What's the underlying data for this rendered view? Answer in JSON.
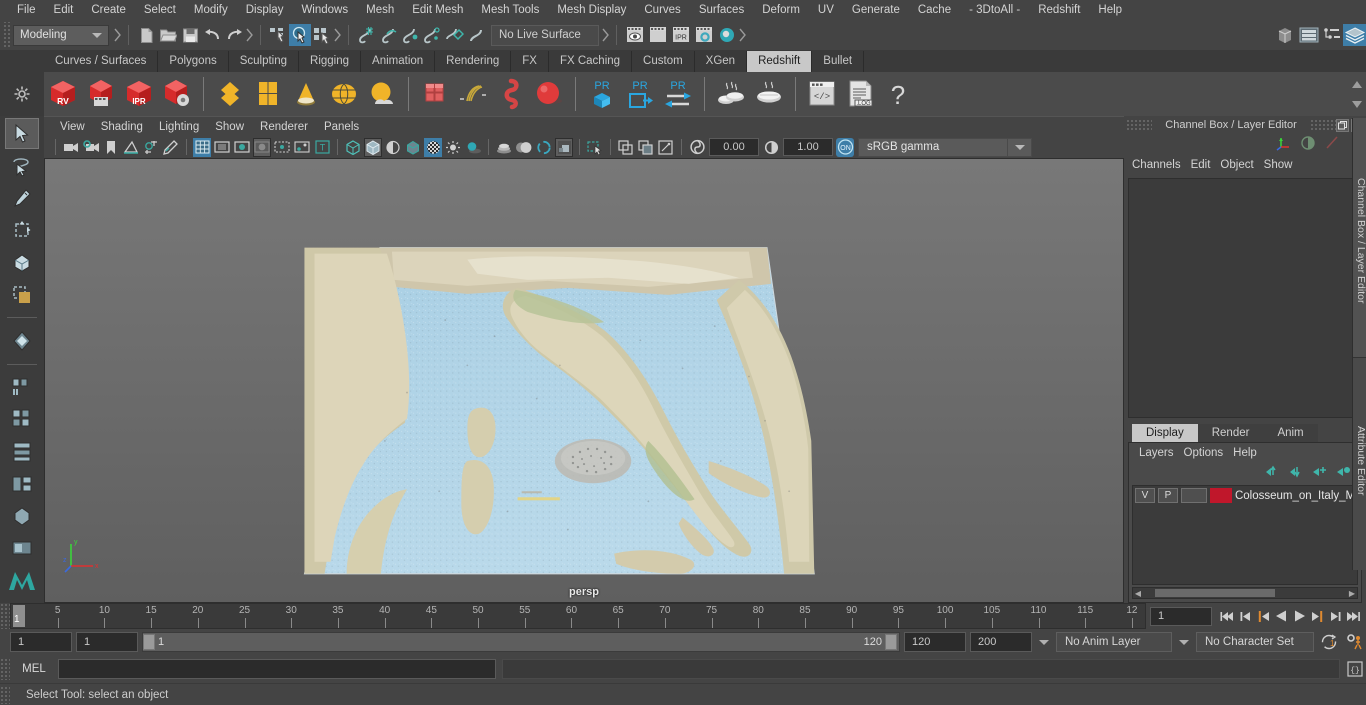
{
  "menubar": {
    "items": [
      "File",
      "Edit",
      "Create",
      "Select",
      "Modify",
      "Display",
      "Windows",
      "Mesh",
      "Edit Mesh",
      "Mesh Tools",
      "Mesh Display",
      "Curves",
      "Surfaces",
      "Deform",
      "UV",
      "Generate",
      "Cache",
      "- 3DtoAll -",
      "Redshift",
      "Help"
    ]
  },
  "statusline": {
    "mode": "Modeling",
    "live_surface": "No Live Surface",
    "icons": [
      "new-scene-icon",
      "open-scene-icon",
      "save-scene-icon",
      "undo-icon",
      "redo-icon",
      "select-hierarchy-icon",
      "select-object-icon",
      "select-component-icon",
      "snap-grid-icon",
      "snap-curve-icon",
      "snap-point-icon",
      "snap-projected-center-icon",
      "snap-view-plane-icon",
      "make-live-icon",
      "render-view-icon",
      "render-sequence-icon",
      "ipr-render-icon",
      "render-settings-icon",
      "hypershade-icon",
      "show-channel-box-icon",
      "show-attribute-editor-icon",
      "show-outliner-icon",
      "show-modeling-toolkit-icon"
    ],
    "right_icons": [
      "show-channel-box-icon",
      "show-attribute-editor-icon",
      "show-outliner-icon",
      "show-modeling-toolkit-icon"
    ]
  },
  "shelf": {
    "tabs": [
      "Curves / Surfaces",
      "Polygons",
      "Sculpting",
      "Rigging",
      "Animation",
      "Rendering",
      "FX",
      "FX Caching",
      "Custom",
      "XGen",
      "Redshift",
      "Bullet"
    ],
    "active_tab": "Redshift",
    "icons": [
      "redshift-render-view-icon",
      "redshift-render-sequence-icon",
      "redshift-ipr-icon",
      "redshift-render-settings-icon",
      "redshift-proxy-icon",
      "redshift-matte-icon",
      "redshift-volume-icon",
      "redshift-dome-light-icon",
      "redshift-environment-icon",
      "redshift-bokeh-icon",
      "redshift-hair-icon",
      "redshift-curve-icon",
      "redshift-sphere-icon",
      "proxy-export-icon",
      "proxy-import-icon",
      "proxy-convert-icon",
      "redshift-tools-icon",
      "redshift-bake-icon",
      "redshift-bake2-icon",
      "script-editor-icon",
      "log-file-icon",
      "help-icon"
    ]
  },
  "toolbox": {
    "items": [
      "select-tool",
      "lasso-select-tool",
      "paint-select-tool",
      "move-tool",
      "rotate-tool",
      "scale-tool",
      "last-tool-icon",
      "show-manipulator-tool",
      "single-view-layout",
      "two-pane-layout",
      "three-pane-layout",
      "four-pane-layout",
      "hypershade-layout",
      "persp-outliner-layout",
      "maya-logo-icon"
    ]
  },
  "viewport": {
    "menus": [
      "View",
      "Shading",
      "Lighting",
      "Show",
      "Renderer",
      "Panels"
    ],
    "toolbar_icons": [
      "select-camera-icon",
      "camera-attributes-icon",
      "bookmark-icon",
      "image-plane-icon",
      "two-d-pan-zoom-icon",
      "grease-pencil-icon",
      "grid-toggle-icon",
      "film-gate-icon",
      "resolution-gate-icon",
      "gate-mask-icon",
      "film-origin-icon",
      "xray-icon",
      "xray-joints-icon",
      "wireframe-icon",
      "smooth-shade-all-icon",
      "smooth-shade-textured-icon",
      "use-all-lights-icon",
      "shadows-icon",
      "screen-space-ao-icon",
      "motion-blur-icon",
      "multisample-icon",
      "depth-of-field-icon",
      "isolate-select-icon",
      "xray-mode-icon",
      "xray-active-component-icon",
      "exposure-icon"
    ],
    "exposure": "0.00",
    "gamma": "1.00",
    "color_management_on": "ON",
    "color_space": "sRGB gamma",
    "camera_label": "persp"
  },
  "right_panel": {
    "title": "Channel Box / Layer Editor",
    "channel_menus": [
      "Channels",
      "Edit",
      "Object",
      "Show"
    ],
    "layer_tabs": [
      "Display",
      "Render",
      "Anim"
    ],
    "active_layer_tab": "Display",
    "layer_menus": [
      "Layers",
      "Options",
      "Help"
    ],
    "layers": [
      {
        "visibility": "V",
        "playback": "P",
        "type": "",
        "color": "#c0172b",
        "name": "Colosseum_on_Italy_M"
      }
    ],
    "side_tabs": [
      "Channel Box / Layer Editor",
      "Attribute Editor"
    ]
  },
  "timeline": {
    "tick_labels": [
      "5",
      "10",
      "15",
      "20",
      "25",
      "30",
      "35",
      "40",
      "45",
      "50",
      "55",
      "60",
      "65",
      "70",
      "75",
      "80",
      "85",
      "90",
      "95",
      "100",
      "105",
      "110",
      "115",
      "12"
    ],
    "current_frame_label": "1",
    "current_frame_field": "1",
    "playback_icons": [
      "go-to-start-icon",
      "step-back-keyframe-icon",
      "step-back-frame-icon",
      "play-backwards-icon",
      "play-forwards-icon",
      "step-forward-frame-icon",
      "step-forward-keyframe-icon",
      "go-to-end-icon"
    ]
  },
  "range": {
    "anim_start": "1",
    "playback_start": "1",
    "slider_start_label": "1",
    "slider_end_label": "120",
    "playback_end": "120",
    "anim_end": "200",
    "anim_layer": "No Anim Layer",
    "character_set": "No Character Set",
    "icons": [
      "auto-keyframe-icon",
      "animation-preferences-icon"
    ]
  },
  "command_line": {
    "label": "MEL",
    "input_value": "",
    "icon": "script-editor-icon"
  },
  "help_line": {
    "text": "Select Tool: select an object"
  },
  "colors": {
    "accent_blue": "#3e7ea8",
    "shelf_red": "#d03030",
    "shelf_yellow": "#f0b429",
    "layer_red": "#c0172b",
    "panel_bg": "#444444",
    "viewport_bg": "#6b6b6b"
  }
}
